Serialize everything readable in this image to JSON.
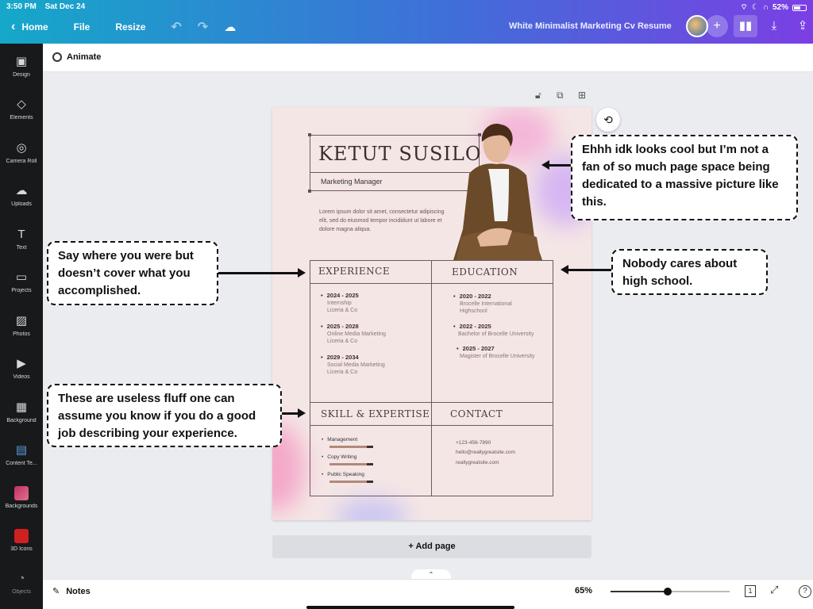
{
  "status": {
    "time": "3:50 PM",
    "date": "Sat Dec 24",
    "battery": "52%"
  },
  "topbar": {
    "home": "Home",
    "file": "File",
    "resize": "Resize",
    "doc_title": "White Minimalist Marketing Cv Resume"
  },
  "sidebar": {
    "items": [
      {
        "label": "Design",
        "icon": "▣"
      },
      {
        "label": "Elements",
        "icon": "◇"
      },
      {
        "label": "Camera Roll",
        "icon": "◎"
      },
      {
        "label": "Uploads",
        "icon": "☁"
      },
      {
        "label": "Text",
        "icon": "T"
      },
      {
        "label": "Projects",
        "icon": "▭"
      },
      {
        "label": "Photos",
        "icon": "▨"
      },
      {
        "label": "Videos",
        "icon": "▶"
      },
      {
        "label": "Background",
        "icon": "▦"
      },
      {
        "label": "Content Te...",
        "icon": "▤"
      },
      {
        "label": "Backgrounds",
        "icon": ""
      },
      {
        "label": "3D Icons",
        "icon": ""
      },
      {
        "label": "Objects",
        "icon": "◔"
      }
    ]
  },
  "subbar": {
    "animate": "Animate"
  },
  "resume": {
    "name": "KETUT SUSILO",
    "role": "Marketing Manager",
    "lorem": "Lorem ipsum dolor sit amet, consectetur adipiscing elit, sed do eiusmod tempor incididunt ut labore et dolore magna aliqua.",
    "experience_title": "EXPERIENCE",
    "experience": [
      {
        "years": "2024 - 2025",
        "line1": "Internship",
        "line2": "Liceria & Co"
      },
      {
        "years": "2025 - 2028",
        "line1": "Online Media Marketing",
        "line2": "Liceria & Co"
      },
      {
        "years": "2029 - 2034",
        "line1": "Social Media Marketing",
        "line2": "Liceria & Co"
      }
    ],
    "education_title": "EDUCATION",
    "education": [
      {
        "years": "2020 - 2022",
        "line1": "Brocelle International",
        "line2": "Highschool"
      },
      {
        "years": "2022 - 2025",
        "line1": "Bachelor of Brocelle University",
        "line2": ""
      },
      {
        "years": "2025 - 2027",
        "line1": "Magister of Brocelle University",
        "line2": ""
      }
    ],
    "skill_title": "SKILL & EXPERTISE",
    "skills": [
      "Management",
      "Copy Writing",
      "Public Speaking"
    ],
    "contact_title": "CONTACT",
    "contact": [
      "+123-456-7890",
      "hello@reallygreatsite.com",
      "reallygreatsite.com"
    ]
  },
  "callouts": {
    "photo": "Ehhh idk looks cool but I’m not a fan of so much page space being dedicated to a massive picture like this.",
    "experience": "Say where you were but doesn’t cover what you accomplished.",
    "education": "Nobody cares about high school.",
    "skills": "These are useless fluff one can assume you know if you do a good job describing your experience."
  },
  "add_page": "+ Add page",
  "bottombar": {
    "notes": "Notes",
    "zoom": "65%",
    "zoom_fraction": 0.48,
    "page_count": "1"
  }
}
